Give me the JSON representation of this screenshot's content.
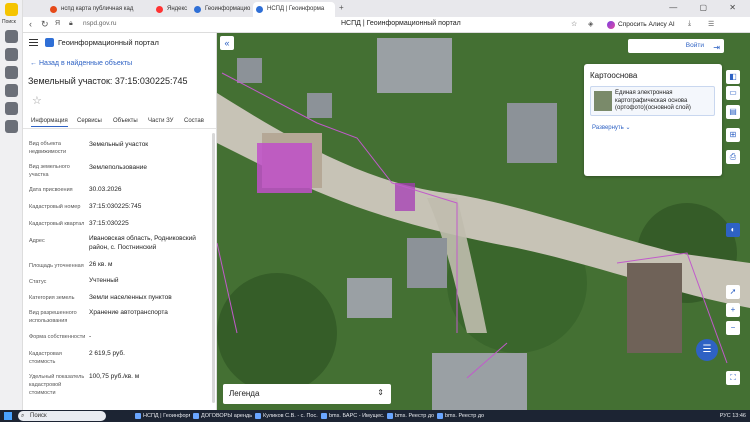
{
  "browser": {
    "rail_label": "Поиск",
    "tabs": [
      {
        "title": "нспд карта публичная кад",
        "color": "#e64a19"
      },
      {
        "title": "Яндекс",
        "color": "#ff3333"
      },
      {
        "title": "Геоинформацио",
        "color": "#2f6fd6"
      },
      {
        "title": "НСПД | Геоинформа",
        "color": "#2f6fd6",
        "active": true
      }
    ],
    "url": "nspd.gov.ru",
    "page_title": "НСПД | Геоинформационный портал",
    "alice_label": "Спросить Алису AI"
  },
  "panel": {
    "portal_title": "Геоинформационный портал",
    "back_link": "Назад в найденные объекты",
    "object_title": "Земельный участок: 37:15:030225:745",
    "tabs": [
      "Информация",
      "Сервисы",
      "Объекты",
      "Части ЗУ",
      "Состав"
    ],
    "properties": [
      {
        "label": "Вид объекта недвижимости",
        "value": "Земельный участок"
      },
      {
        "label": "Вид земельного участка",
        "value": "Землепользование"
      },
      {
        "label": "Дата присвоения",
        "value": "30.03.2026"
      },
      {
        "label": "Кадастровый номер",
        "value": "37:15:030225:745"
      },
      {
        "label": "Кадастровый квартал",
        "value": "37:15:030225"
      },
      {
        "label": "Адрес",
        "value": "Ивановская область, Родниковский район, с. Постнинский"
      },
      {
        "label": "Площадь уточненная",
        "value": "26 кв. м"
      },
      {
        "label": "Статус",
        "value": "Учтенный"
      },
      {
        "label": "Категория земель",
        "value": "Земли населенных пунктов"
      },
      {
        "label": "Вид разрешенного использования",
        "value": "Хранение автотранспорта"
      },
      {
        "label": "Форма собственности",
        "value": "-"
      },
      {
        "label": "Кадастровая стоимость",
        "value": "2 619,5 руб."
      },
      {
        "label": "Удельный показатель кадастровой стоимости",
        "value": "100,75 руб./кв. м"
      }
    ]
  },
  "map": {
    "login_label": "Войти",
    "basemap": {
      "title": "Картооснова",
      "item_text": "Единая электронная картографическая основа (ортофото)(основной слой)",
      "more_label": "Развернуть"
    },
    "legend_label": "Легенда"
  },
  "taskbar": {
    "search_label": "Поиск",
    "items": [
      "НСПД | Геоинформац...",
      "ДОГОВОРЫ аренды ...",
      "Куликов С.В. - с. Пос...",
      "bms. БАРС - Имущес...",
      "bms. Реестр договор...",
      "bms. Реестр договор..."
    ],
    "tray": "РУС   13:46"
  }
}
